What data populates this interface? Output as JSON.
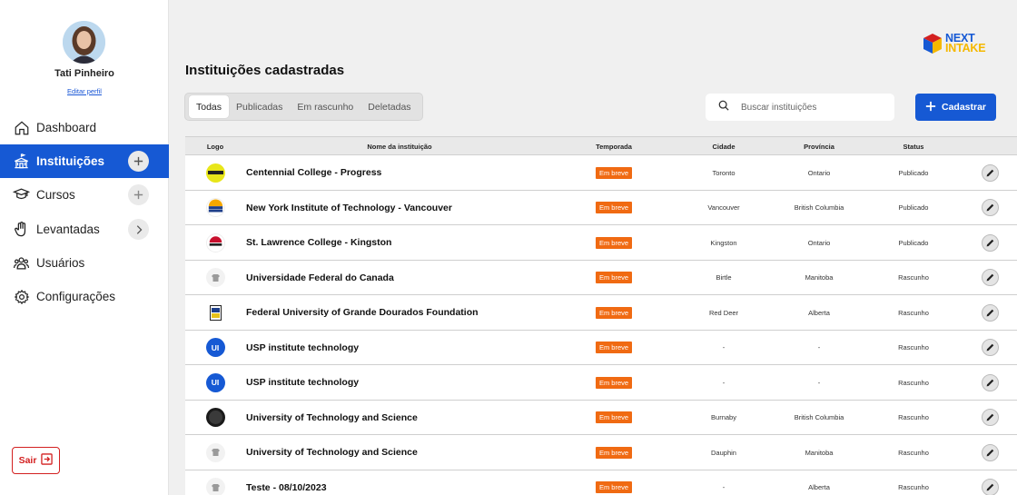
{
  "profile": {
    "name": "Tati Pinheiro",
    "edit_label": "Editar perfil"
  },
  "nav": [
    {
      "label": "Dashboard",
      "icon": "home-icon"
    },
    {
      "label": "Instituições",
      "icon": "institution-icon",
      "action": "plus-icon",
      "active": true
    },
    {
      "label": "Cursos",
      "icon": "graduation-cap-icon",
      "action": "plus-icon"
    },
    {
      "label": "Levantadas",
      "icon": "raised-hand-icon",
      "action": "chevron-right-icon"
    },
    {
      "label": "Usuários",
      "icon": "users-icon"
    },
    {
      "label": "Configurações",
      "icon": "gear-icon"
    }
  ],
  "logout_label": "Sair",
  "brand": {
    "line1": "NEXT",
    "line2": "INTAKE",
    "colors": {
      "primary": "#1659d4",
      "secondary": "#f5b800",
      "accent": "#d32020"
    }
  },
  "page_title": "Instituições cadastradas",
  "tabs": [
    "Todas",
    "Publicadas",
    "Em rascunho",
    "Deletadas"
  ],
  "active_tab": "Todas",
  "search": {
    "placeholder": "Buscar instituições",
    "value": ""
  },
  "add_button_label": "Cadastrar",
  "columns": [
    "Logo",
    "Nome da instituição",
    "Temporada",
    "Cidade",
    "Província",
    "Status"
  ],
  "rows": [
    {
      "logo": "centennial-logo",
      "name": "Centennial College - Progress",
      "season": "Em breve",
      "city": "Toronto",
      "province": "Ontario",
      "status": "Publicado"
    },
    {
      "logo": "nyit-logo",
      "name": "New York Institute of Technology - Vancouver",
      "season": "Em breve",
      "city": "Vancouver",
      "province": "British Columbia",
      "status": "Publicado"
    },
    {
      "logo": "stlawrence-logo",
      "name": "St. Lawrence College - Kingston",
      "season": "Em breve",
      "city": "Kingston",
      "province": "Ontario",
      "status": "Publicado"
    },
    {
      "logo": "placeholder-logo",
      "name": "Universidade Federal do Canada",
      "season": "Em breve",
      "city": "Birtle",
      "province": "Manitoba",
      "status": "Rascunho"
    },
    {
      "logo": "ufgd-logo",
      "name": "Federal University of Grande Dourados Foundation",
      "season": "Em breve",
      "city": "Red Deer",
      "province": "Alberta",
      "status": "Rascunho"
    },
    {
      "logo": "ui-logo",
      "name": "USP institute technology",
      "season": "Em breve",
      "city": "-",
      "province": "-",
      "status": "Rascunho"
    },
    {
      "logo": "ui-logo",
      "name": "USP institute technology",
      "season": "Em breve",
      "city": "-",
      "province": "-",
      "status": "Rascunho"
    },
    {
      "logo": "dark-logo",
      "name": "University of Technology and Science",
      "season": "Em breve",
      "city": "Burnaby",
      "province": "British Columbia",
      "status": "Rascunho"
    },
    {
      "logo": "placeholder-logo",
      "name": "University of Technology and Science",
      "season": "Em breve",
      "city": "Dauphin",
      "province": "Manitoba",
      "status": "Rascunho"
    },
    {
      "logo": "placeholder-logo",
      "name": "Teste - 08/10/2023",
      "season": "Em breve",
      "city": "-",
      "province": "Alberta",
      "status": "Rascunho"
    }
  ]
}
